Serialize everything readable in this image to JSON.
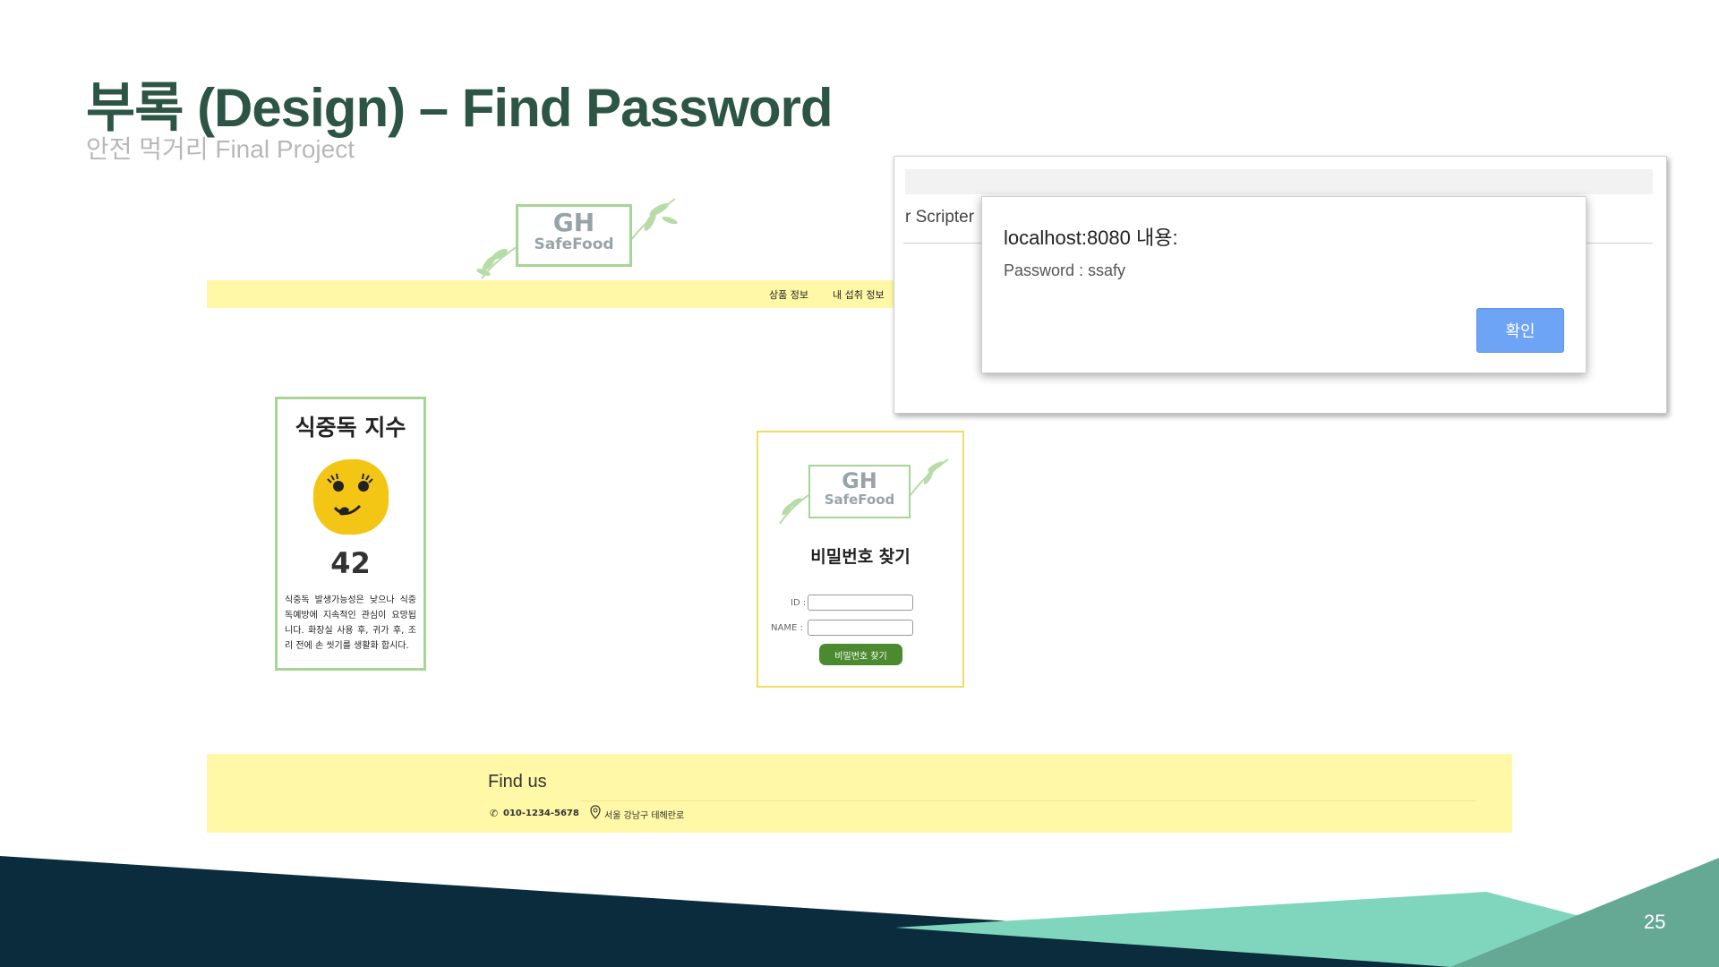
{
  "slide": {
    "title": "부록 (Design) – Find Password",
    "subtitle": "안전 먹거리 Final Project",
    "page_number": "25"
  },
  "logo": {
    "line1": "GH",
    "line2": "SafeFood"
  },
  "nav": {
    "items": [
      "상품 정보",
      "내 섭취 정보"
    ]
  },
  "food_poisoning": {
    "title": "식중독 지수",
    "value": "42",
    "description": "식중독 발생가능성은 낮으나 식중독예방에 지속적인 관심이 요망됩니다. 화장실 사용 후, 귀가 후, 조리 전에 손 씻기를 생활화 합시다."
  },
  "find_password": {
    "title": "비밀번호 찾기",
    "id_label": "ID :",
    "id_value": "",
    "name_label": "NAME :",
    "name_value": "",
    "button_label": "비밀번호 찾기"
  },
  "browser": {
    "background_text": "r Scripter"
  },
  "alert": {
    "title": "localhost:8080 내용:",
    "message": "Password : ssafy",
    "ok_label": "확인"
  },
  "footer": {
    "heading": "Find us",
    "phone": "010-1234-5678",
    "address": "서울 강남구 테헤란로"
  },
  "colors": {
    "title_green": "#2c5545",
    "nav_yellow": "#fff8a6",
    "card_green_border": "#a6d596",
    "card_yellow_border": "#f2dc63",
    "button_green": "#4b8a2e",
    "alert_blue": "#6ea4f5",
    "navy": "#0b2c3d",
    "teal": "#7fd6bd"
  },
  "icons": [
    "phone-icon",
    "location-pin-icon",
    "leaf-icon",
    "smiley-face-icon"
  ]
}
